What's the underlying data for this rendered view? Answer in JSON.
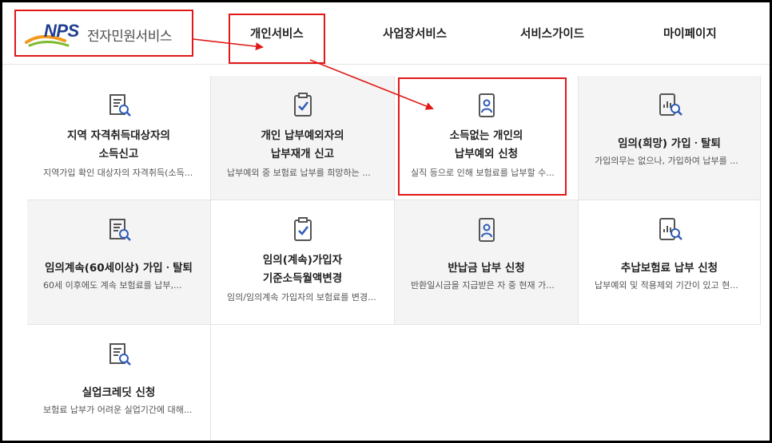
{
  "header": {
    "logo_brand": "NPS",
    "logo_text": "전자민원서비스",
    "nav": [
      "개인서비스",
      "사업장서비스",
      "서비스가이드",
      "마이페이지"
    ]
  },
  "cards": [
    {
      "icon": "document-search-icon",
      "title_lines": [
        "지역 자격취득대상자의",
        "소득신고"
      ],
      "desc": "지역가입 확인 대상자의 자격취득(소득..."
    },
    {
      "icon": "clipboard-check-icon",
      "title_lines": [
        "개인 납부예외자의",
        "납부재개 신고"
      ],
      "desc": "납부예외 중 보험료 납부를 희망하는 ..."
    },
    {
      "icon": "id-badge-icon",
      "title_lines": [
        "소득없는 개인의",
        "납부예외 신청"
      ],
      "desc": "실직 등으로 인해 보험료를 납부할 수..."
    },
    {
      "icon": "tablet-chart-search-icon",
      "title_lines": [
        "임의(희망) 가입ㆍ탈퇴"
      ],
      "desc": "가입의무는 없으나, 가입하여 납부를 ..."
    },
    {
      "icon": "document-search-icon",
      "title_lines": [
        "임의계속(60세이상) 가입ㆍ탈퇴"
      ],
      "desc": "60세 이후에도 계속 보험료를 납부,..."
    },
    {
      "icon": "clipboard-check-icon",
      "title_lines": [
        "임의(계속)가입자",
        "기준소득월액변경"
      ],
      "desc": "임의/임의계속 가입자의 보험료를 변경..."
    },
    {
      "icon": "id-badge-icon",
      "title_lines": [
        "반납금 납부 신청"
      ],
      "desc": "반환일시금을 지급받은 자 중 현재 가..."
    },
    {
      "icon": "tablet-chart-search-icon",
      "title_lines": [
        "추납보험료 납부 신청"
      ],
      "desc": "납부예외 및 적용제외 기간이 있고 현..."
    },
    {
      "icon": "document-search-icon",
      "title_lines": [
        "실업크레딧 신청"
      ],
      "desc": "보험료 납부가 어려운 실업기간에 대해..."
    }
  ],
  "colors": {
    "annotation": "#e01818",
    "brand_blue": "#1f3e8f",
    "icon_gray": "#555555",
    "icon_blue": "#2f5bb7"
  }
}
